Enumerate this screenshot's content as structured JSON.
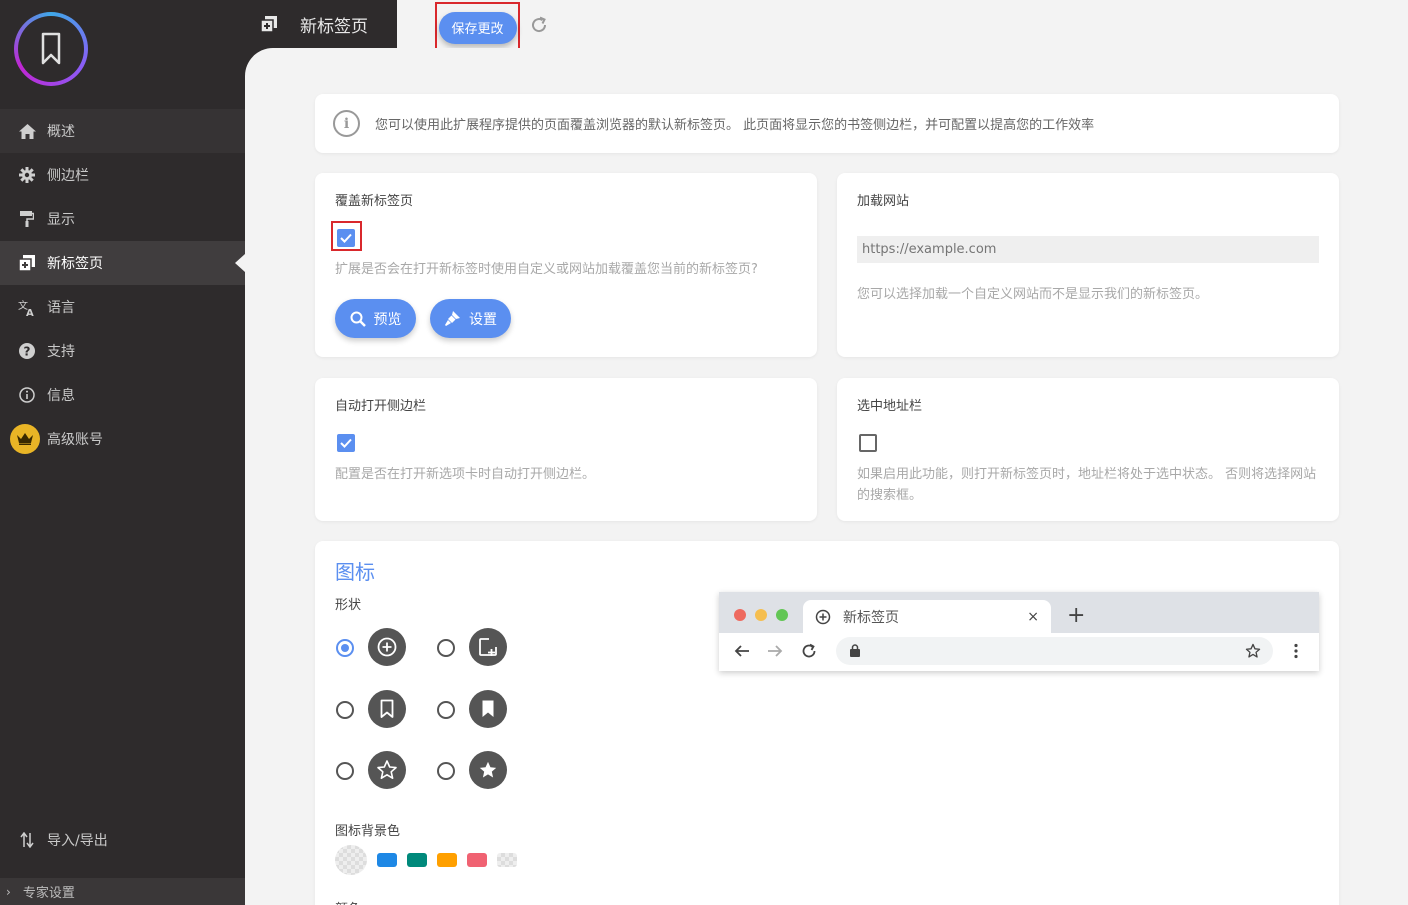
{
  "sidebar": {
    "items": [
      {
        "label": "概述",
        "icon": "home-icon"
      },
      {
        "label": "侧边栏",
        "icon": "gear-icon"
      },
      {
        "label": "显示",
        "icon": "paint-roller-icon"
      },
      {
        "label": "新标签页",
        "icon": "new-tab-icon"
      },
      {
        "label": "语言",
        "icon": "translate-icon"
      },
      {
        "label": "支持",
        "icon": "question-icon"
      },
      {
        "label": "信息",
        "icon": "info-icon"
      },
      {
        "label": "高级账号",
        "icon": "crown-icon"
      }
    ],
    "import_export": "导入/导出",
    "expert_settings": "专家设置"
  },
  "header": {
    "title": "新标签页",
    "save_label": "保存更改"
  },
  "info_banner": {
    "icon": "i",
    "text": "您可以使用此扩展程序提供的页面覆盖浏览器的默认新标签页。 此页面将显示您的书签侧边栏，并可配置以提高您的工作效率"
  },
  "override_card": {
    "title": "覆盖新标签页",
    "checked": true,
    "description": "扩展是否会在打开新标签时使用自定义或网站加载覆盖您当前的新标签页?",
    "preview_label": "预览",
    "settings_label": "设置"
  },
  "load_site_card": {
    "title": "加载网站",
    "placeholder": "https://example.com",
    "description": "您可以选择加载一个自定义网站而不是显示我们的新标签页。"
  },
  "auto_open_card": {
    "title": "自动打开侧边栏",
    "checked": true,
    "description": "配置是否在打开新选项卡时自动打开侧边栏。"
  },
  "select_address_card": {
    "title": "选中地址栏",
    "checked": false,
    "description": "如果启用此功能，则打开新标签页时，地址栏将处于选中状态。 否则将选择网站的搜索框。"
  },
  "icons_section": {
    "title": "图标",
    "shape_label": "形状",
    "shapes": [
      "add-circle-icon",
      "add-square-icon",
      "bookmark-outline-icon",
      "bookmark-filled-icon",
      "star-outline-icon",
      "star-filled-icon"
    ],
    "selected_shape": "add-circle-icon",
    "bg_color_label": "图标背景色",
    "bg_colors": [
      "transparent",
      "#1e88e5",
      "#00897b",
      "#ffa000",
      "#f06272",
      "transparent"
    ],
    "next_label": "颜色"
  },
  "browser_preview": {
    "tab_title": "新标签页",
    "close": "×",
    "plus": "+"
  },
  "colors": {
    "accent": "#5b8ff0",
    "sidebar_bg": "#2e2b2c",
    "highlight_frame": "#d9282c",
    "crown": "#e9b526"
  }
}
